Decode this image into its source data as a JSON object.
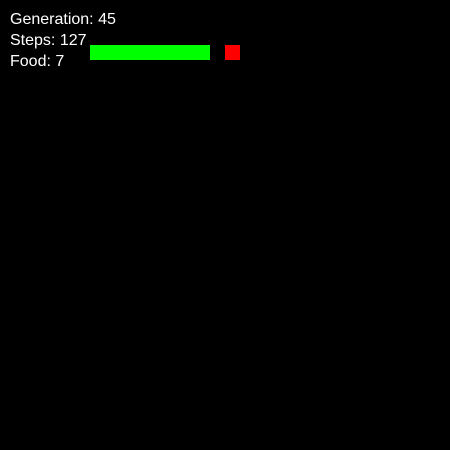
{
  "hud": {
    "generation_label": "Generation: ",
    "generation": "45",
    "steps_label": "Steps: ",
    "steps": "127",
    "food_label": "Food: ",
    "food": "7"
  },
  "colors": {
    "background": "#000000",
    "text": "#ffffff",
    "snake": "#00ff00",
    "food": "#ff0000"
  },
  "game": {
    "cell_size_units": 1,
    "snake": [
      [
        6,
        3
      ],
      [
        7,
        3
      ],
      [
        8,
        3
      ],
      [
        9,
        3
      ],
      [
        10,
        3
      ],
      [
        11,
        3
      ],
      [
        12,
        3
      ],
      [
        13,
        3
      ]
    ],
    "food_cell": [
      15,
      3
    ]
  }
}
